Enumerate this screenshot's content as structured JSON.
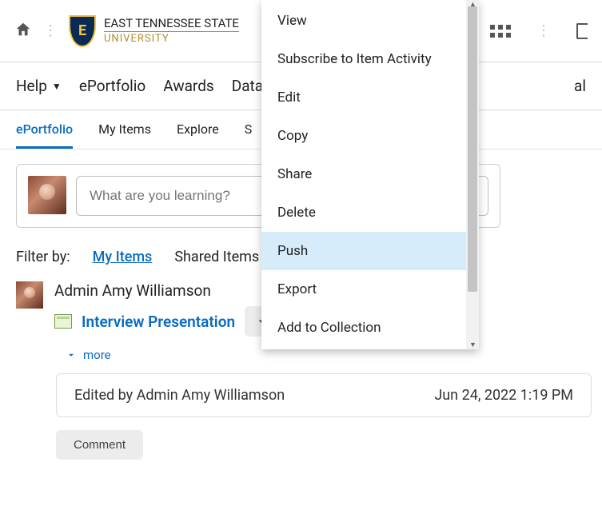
{
  "brand": {
    "shield_letter": "E",
    "line1": "EAST TENNESSEE STATE",
    "line2": "UNIVERSITY"
  },
  "nav": {
    "help": "Help",
    "items": [
      "ePortfolio",
      "Awards",
      "Data"
    ],
    "cutoff": "al"
  },
  "subnav": {
    "tabs": [
      "ePortfolio",
      "My Items",
      "Explore"
    ],
    "cutoff": "S",
    "active_index": 0
  },
  "compose": {
    "placeholder": "What are you learning?"
  },
  "filter": {
    "label": "Filter by:",
    "my_items": "My Items",
    "shared": "Shared Items"
  },
  "feed": {
    "author": "Admin Amy Williamson",
    "item_title": "Interview Presentation",
    "more": "more",
    "edited_by": "Edited by Admin Amy Williamson",
    "edited_at": "Jun 24, 2022 1:19 PM",
    "comment": "Comment"
  },
  "dropdown": {
    "items": [
      "View",
      "Subscribe to Item Activity",
      "Edit",
      "Copy",
      "Share",
      "Delete",
      "Push",
      "Export",
      "Add to Collection"
    ],
    "highlight_index": 6
  }
}
